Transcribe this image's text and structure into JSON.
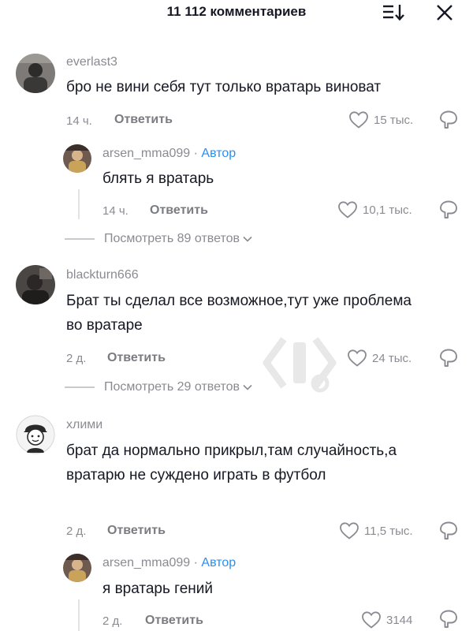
{
  "header": {
    "title": "11 112 комментариев"
  },
  "icons": {
    "sort": "sort-icon",
    "close": "close-icon",
    "like": "heart-icon",
    "dislike": "dislike-icon",
    "chevron": "chevron-down-icon"
  },
  "colors": {
    "author_badge": "#2a8ff0",
    "muted": "#8a8b91",
    "text": "#161823"
  },
  "comments": [
    {
      "username": "everlast3",
      "text": "бро не вини себя тут только вратарь виноват",
      "time": "14 ч.",
      "reply_label": "Ответить",
      "likes": "15 тыс.",
      "replies": [
        {
          "username": "arsen_mma099",
          "author_label": "Автор",
          "text": "блять я вратарь",
          "time": "14 ч.",
          "reply_label": "Ответить",
          "likes": "10,1 тыс."
        }
      ],
      "view_replies": "Посмотреть 89 ответов"
    },
    {
      "username": "blackturn666",
      "text": "Брат ты сделал все возможное,тут уже проблема во вратаре",
      "time": "2 д.",
      "reply_label": "Ответить",
      "likes": "24 тыс.",
      "view_replies": "Посмотреть 29 ответов"
    },
    {
      "username": "хлими",
      "text": "брат да нормально прикрыл,там случайность,а вратарю не суждено играть в футбол",
      "time": "2 д.",
      "reply_label": "Ответить",
      "likes": "11,5 тыс.",
      "replies": [
        {
          "username": "arsen_mma099",
          "author_label": "Автор",
          "text": "я вратарь гений",
          "time": "2 д.",
          "reply_label": "Ответить",
          "likes": "3144"
        }
      ]
    }
  ]
}
